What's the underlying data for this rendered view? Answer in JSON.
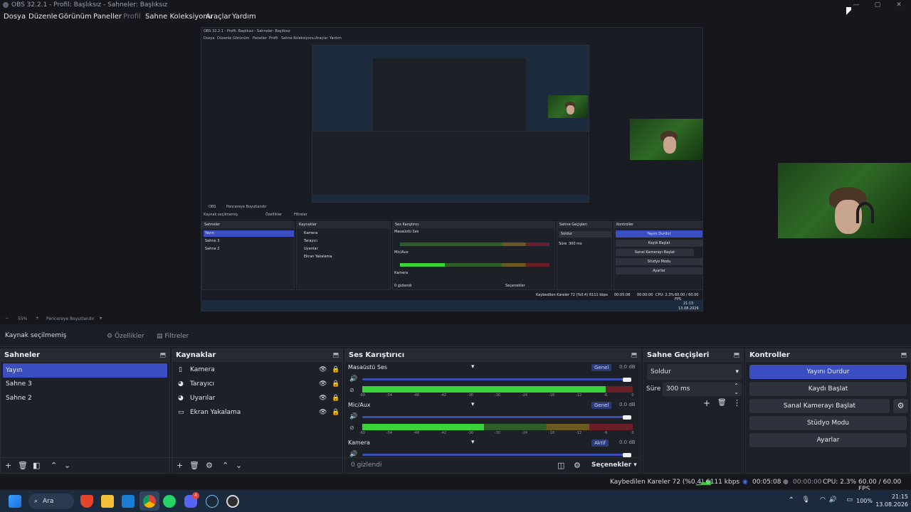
{
  "window": {
    "title": "OBS 32.2.1 - Profil: Başlıksız - Sahneler: Başlıksız",
    "controls": [
      "minimize-icon",
      "maximize-icon",
      "close-icon"
    ]
  },
  "menu": {
    "items": [
      "Dosya",
      "Düzenle",
      "Görünüm",
      "Paneller",
      "Profil",
      "Sahne Koleksiyonu",
      "Araçlar",
      "Yardım"
    ],
    "disabled_item": "Profil"
  },
  "nested_preview": {
    "title": "OBS 32.2.1 - Profil: Başlıksız - Sahneler: Başlıksız",
    "menu": [
      "Dosya",
      "Düzenle",
      "Görünüm",
      "Paneller",
      "Profil",
      "Sahne Koleksiyonu",
      "Araçlar",
      "Yardım"
    ],
    "source_status": "Kaynak seçilmemiş",
    "properties": "Özellikler",
    "filters": "Filtreler",
    "docks": {
      "scenes": "Sahneler",
      "sources": "Kaynaklar",
      "mixer": "Ses Karıştırıcı",
      "transitions": "Sahne Geçişleri",
      "controls": "Kontroller"
    },
    "scenes": [
      "Yayın",
      "Sahne 3",
      "Sahne 2"
    ],
    "sources": [
      "Kamera",
      "Tarayıcı",
      "Uyarılar",
      "Ekran Yakalama"
    ],
    "mixer_channels": [
      "Masaüstü Ses",
      "Mic/Aux",
      "Kamera"
    ],
    "transition": "Soldur",
    "duration_label": "Süre",
    "duration": "300 ms",
    "control_buttons": [
      "Yayını Durdur",
      "Kaydı Başlat",
      "Sanal Kamerayı Başlat",
      "Stüdyo Modu",
      "Ayarlar"
    ],
    "hidden": "0 gizlendi",
    "options": "Seçenekler",
    "status": "Kaybedilen Kareler 72 (%0.4)",
    "bitrate": "6111 kbps",
    "time1": "00:05:08",
    "time2": "00:00:00",
    "cpu": "CPU: 2.3%",
    "fps": "60.00 / 60.00 FPS",
    "clock_time": "21:15",
    "clock_date": "13.08.2026",
    "zoom": "OBS",
    "zoom_label": "Pencereye Boyutlandır"
  },
  "zoom_bar": {
    "zoom": "55%",
    "fit_label": "Pencereye Boyutlandır"
  },
  "source_bar": {
    "status": "Kaynak seçilmemiş",
    "properties": "Özellikler",
    "filters": "Filtreler"
  },
  "scenes": {
    "title": "Sahneler",
    "items": [
      "Yayın",
      "Sahne 3",
      "Sahne 2"
    ],
    "selected_index": 0
  },
  "sources": {
    "title": "Kaynaklar",
    "items": [
      {
        "label": "Kamera",
        "icon": "camera-icon"
      },
      {
        "label": "Tarayıcı",
        "icon": "globe-icon"
      },
      {
        "label": "Uyarılar",
        "icon": "globe-icon"
      },
      {
        "label": "Ekran Yakalama",
        "icon": "monitor-icon"
      }
    ]
  },
  "mixer": {
    "title": "Ses Karıştırıcı",
    "scale": [
      "-60",
      "-54",
      "-48",
      "-42",
      "-36",
      "-30",
      "-24",
      "-18",
      "-12",
      "-6",
      "0"
    ],
    "channels": [
      {
        "name": "Masaüstü Ses",
        "badge": "Genel",
        "db": "0.0 dB",
        "level": 0.9
      },
      {
        "name": "Mic/Aux",
        "badge": "Genel",
        "db": "0.0 dB",
        "level": 0.45
      },
      {
        "name": "Kamera",
        "badge": "Aktif",
        "db": "0.0 dB",
        "level": 0
      }
    ],
    "hidden": "0 gizlendi",
    "options": "Seçenekler"
  },
  "transitions": {
    "title": "Sahne Geçişleri",
    "selected": "Soldur",
    "duration_label": "Süre",
    "duration": "300 ms"
  },
  "controls": {
    "title": "Kontroller",
    "buttons": [
      "Yayını Durdur",
      "Kaydı Başlat",
      "Sanal Kamerayı Başlat",
      "Stüdyo Modu",
      "Ayarlar"
    ]
  },
  "status": {
    "dropped": "Kaybedilen Kareler 72 (%0.4)",
    "bitrate": "6111 kbps",
    "stream_time": "00:05:08",
    "record_time": "00:00:00",
    "cpu": "CPU: 2.3%",
    "fps": "60.00 / 60.00 FPS"
  },
  "taskbar": {
    "search": "Ara",
    "apps": [
      "start-icon",
      "search-icon",
      "brave-icon",
      "folder-icon",
      "outlook-icon",
      "chrome-icon",
      "whatsapp-icon",
      "discord-icon",
      "steam-icon",
      "obs-icon"
    ],
    "discord_badge": "4",
    "battery": "100%",
    "time": "21:15",
    "date": "13.08.2026"
  },
  "colors": {
    "accent": "#3a4ec2",
    "panel": "#1e2028",
    "background": "#1a1c23",
    "meter_green": "#2e5f2b",
    "meter_active": "#39d33a",
    "meter_yellow": "#6b5a1f",
    "meter_red": "#6a1f28"
  }
}
